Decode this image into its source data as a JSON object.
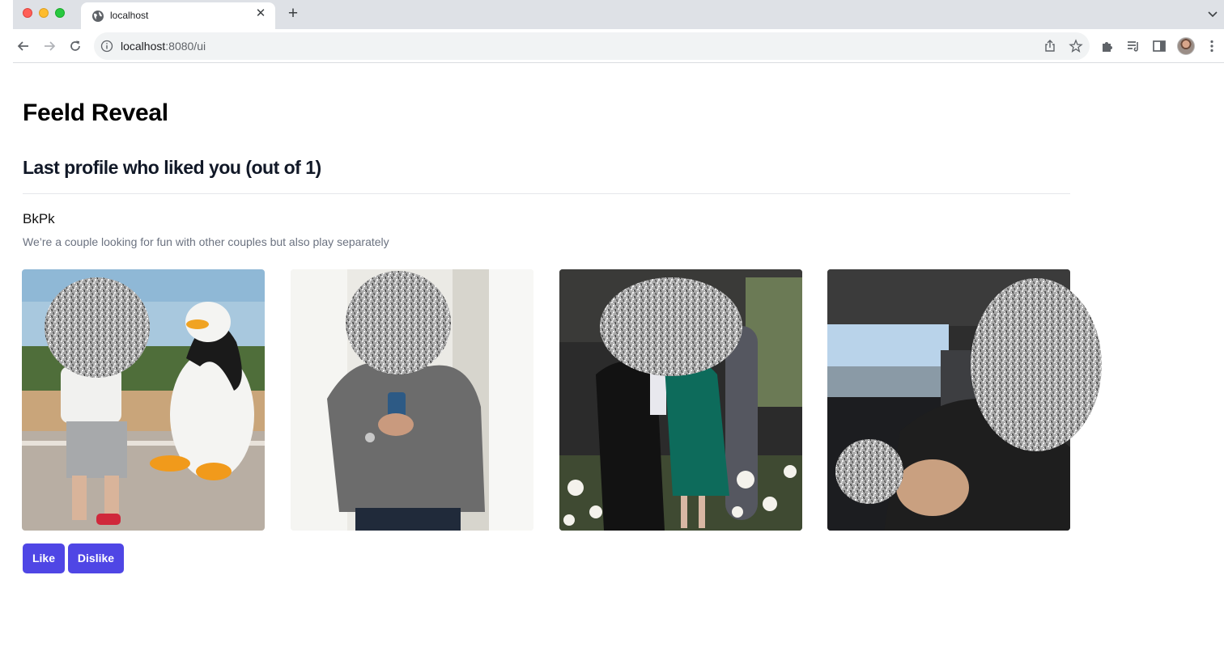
{
  "browser": {
    "tab_title": "localhost",
    "url_host": "localhost",
    "url_path": ":8080/ui"
  },
  "page": {
    "title": "Feeld Reveal",
    "section_title": "Last profile who liked you (out of 1)",
    "profile": {
      "name": "BkPk",
      "bio": "We’re a couple looking for fun with other couples but also play separately"
    },
    "photos": [
      "photo-1",
      "photo-2",
      "photo-3",
      "photo-4"
    ],
    "buttons": {
      "like": "Like",
      "dislike": "Dislike"
    }
  },
  "colors": {
    "button": "#4f46e5",
    "divider": "#e5e7eb",
    "bio_text": "#6b7280"
  }
}
